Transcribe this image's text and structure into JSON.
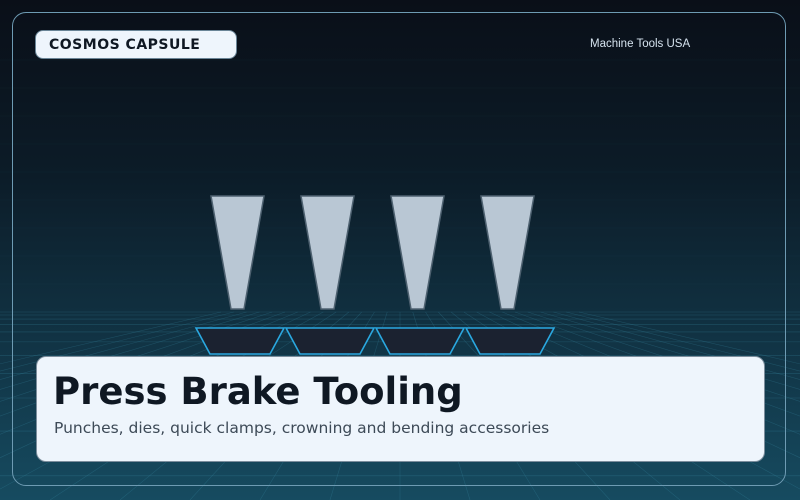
{
  "header": {
    "brand": "COSMOS CAPSULE",
    "tagline": "Machine Tools USA"
  },
  "caption": {
    "title": "Press Brake Tooling",
    "subtitle": "Punches, dies, quick clamps, crowning and bending accessories"
  },
  "illustration": {
    "punch_count": 4,
    "die_count": 4
  },
  "colors": {
    "punch_fill": "#b9c7d4",
    "punch_stroke": "#4e6170",
    "die_fill": "#1b2230",
    "die_stroke": "#2aa8e0",
    "grid_line": "#3c8ea8",
    "card_bg": "#eef5fc"
  }
}
